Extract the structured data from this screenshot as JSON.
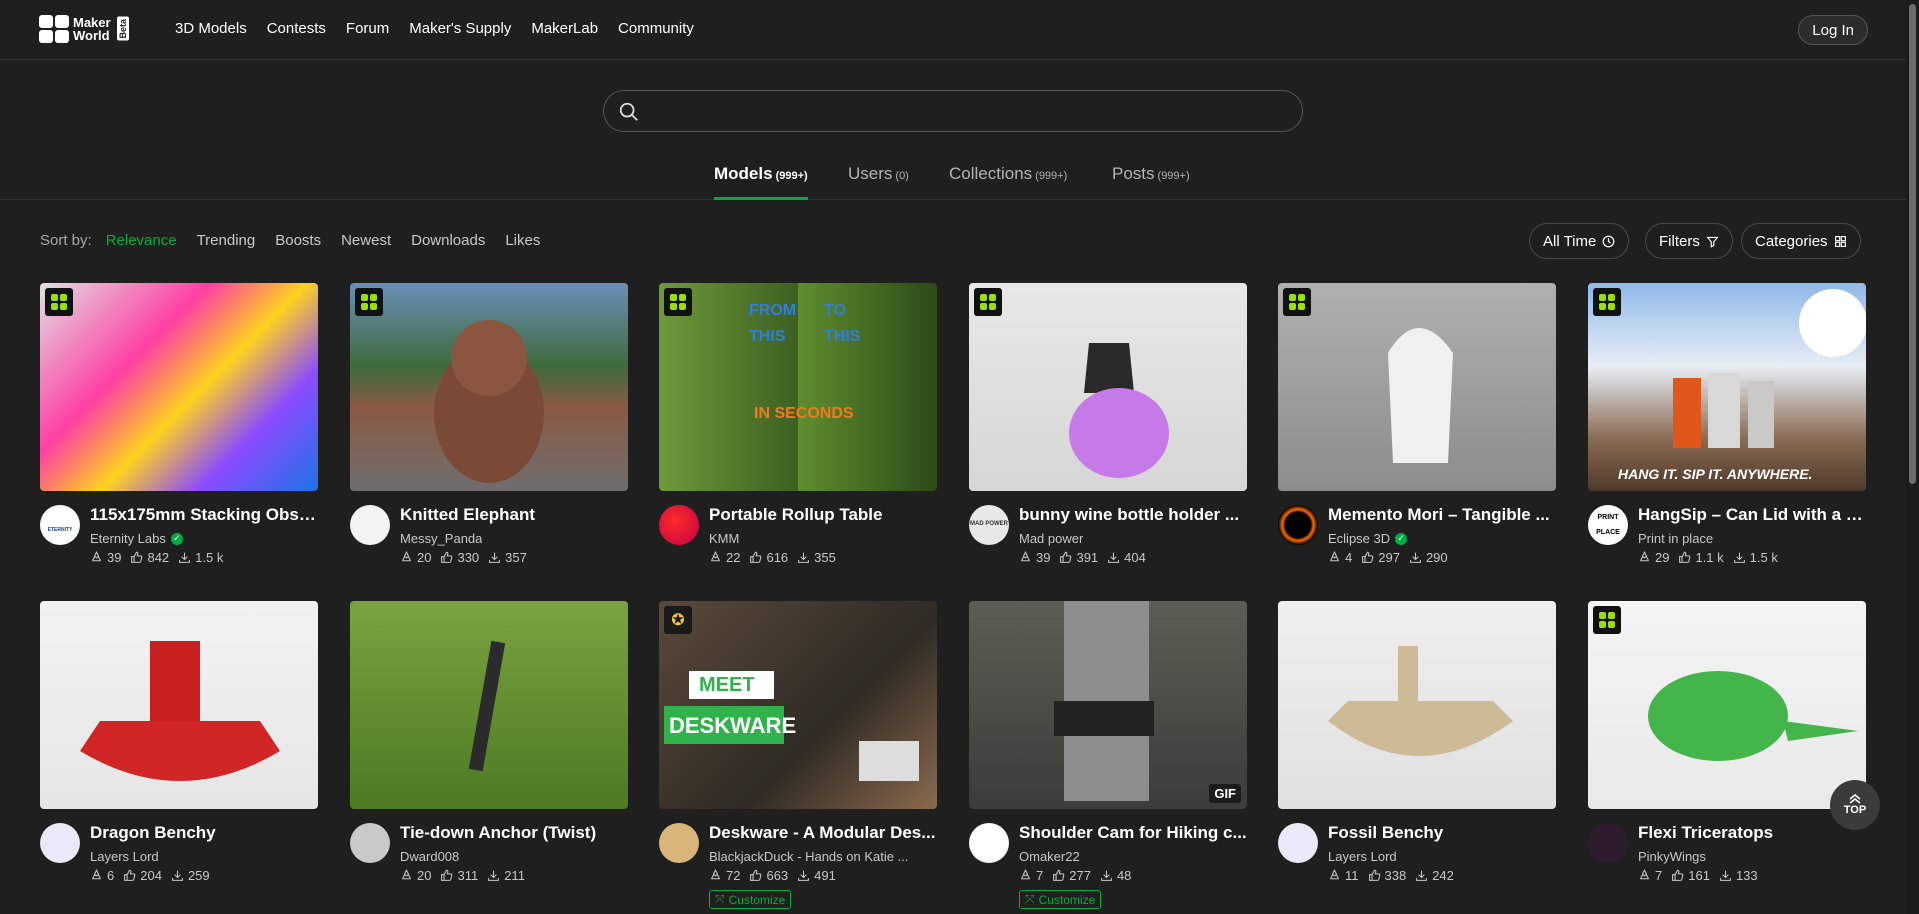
{
  "app": {
    "logo_text_line1": "Maker",
    "logo_text_line2": "World",
    "beta": "Beta"
  },
  "nav": [
    "3D Models",
    "Contests",
    "Forum",
    "Maker's Supply",
    "MakerLab",
    "Community"
  ],
  "login_label": "Log In",
  "search": {
    "value": "",
    "placeholder": ""
  },
  "tabs": [
    {
      "label": "Models",
      "count": "(999+)",
      "active": true
    },
    {
      "label": "Users",
      "count": "(0)"
    },
    {
      "label": "Collections",
      "count": "(999+)"
    },
    {
      "label": "Posts",
      "count": "(999+)"
    }
  ],
  "sort": {
    "label": "Sort by:",
    "options": [
      "Relevance",
      "Trending",
      "Boosts",
      "Newest",
      "Downloads",
      "Likes"
    ],
    "selected": "Relevance"
  },
  "filters": {
    "time": "All Time",
    "filters": "Filters",
    "categories": "Categories"
  },
  "cards": [
    {
      "title": "115x175mm Stacking Obse...",
      "author": "Eternity Labs",
      "verified": true,
      "boosts": "39",
      "likes": "842",
      "downloads": "1.5 k",
      "badge": "grid"
    },
    {
      "title": "Knitted Elephant",
      "author": "Messy_Panda",
      "boosts": "20",
      "likes": "330",
      "downloads": "357",
      "badge": "grid"
    },
    {
      "title": "Portable Rollup Table",
      "author": "KMM",
      "boosts": "22",
      "likes": "616",
      "downloads": "355",
      "badge": "grid",
      "overlay": [
        "FROM",
        "TO",
        "THIS",
        "THIS",
        "IN SECONDS"
      ]
    },
    {
      "title": "bunny wine bottle holder ...",
      "author": "Mad power",
      "boosts": "39",
      "likes": "391",
      "downloads": "404",
      "badge": "grid"
    },
    {
      "title": "Memento Mori – Tangible ...",
      "author": "Eclipse 3D",
      "verified": true,
      "boosts": "4",
      "likes": "297",
      "downloads": "290",
      "badge": "grid"
    },
    {
      "title": "HangSip – Can Lid with a S...",
      "author": "Print in place",
      "boosts": "29",
      "likes": "1.1 k",
      "downloads": "1.5 k",
      "badge": "grid",
      "overlay": [
        "HANG IT. SIP IT. ANYWHERE."
      ]
    },
    {
      "title": "Dragon Benchy",
      "author": "Layers Lord",
      "boosts": "6",
      "likes": "204",
      "downloads": "259"
    },
    {
      "title": "Tie-down Anchor (Twist)",
      "author": "Dward008",
      "boosts": "20",
      "likes": "311",
      "downloads": "211"
    },
    {
      "title": "Deskware - A Modular Des...",
      "author": "BlackjackDuck - Hands on Katie ...",
      "boosts": "72",
      "likes": "663",
      "downloads": "491",
      "badge": "award",
      "customize": "Customize",
      "overlay": [
        "MEET",
        "DESKWARE"
      ]
    },
    {
      "title": "Shoulder Cam for Hiking c...",
      "author": "Omaker22",
      "boosts": "7",
      "likes": "277",
      "downloads": "48",
      "gif": "GIF",
      "customize": "Customize"
    },
    {
      "title": "Fossil Benchy",
      "author": "Layers Lord",
      "boosts": "11",
      "likes": "338",
      "downloads": "242"
    },
    {
      "title": "Flexi Triceratops",
      "author": "PinkyWings",
      "boosts": "7",
      "likes": "161",
      "downloads": "133",
      "badge": "grid"
    }
  ],
  "avatar_text": {
    "eternity": "ETERNITY",
    "madpower": "MAD POWER",
    "printinplace": [
      "PRINT",
      "PLACE"
    ]
  },
  "top_label": "TOP",
  "colors": {
    "accent": "#00ae42",
    "bg": "#1f1f1f",
    "badge": "#9be000"
  }
}
